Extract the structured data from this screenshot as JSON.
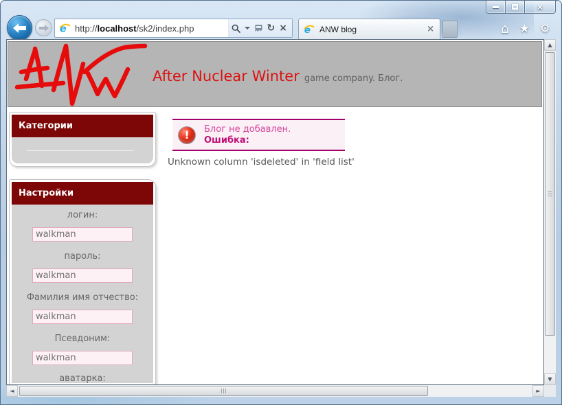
{
  "browser": {
    "url": {
      "prefix": "http://",
      "host": "localhost",
      "path": "/sk2/index.php"
    },
    "tab_title": "ANW blog"
  },
  "icons": {
    "minimize": "",
    "maximize": "",
    "close": "×",
    "refresh": "↻",
    "stop": "×",
    "tab_close": "×",
    "home": "⌂",
    "favorites": "★",
    "tools": "⚙",
    "scroll_up": "▲",
    "scroll_down": "▼",
    "scroll_left": "◄",
    "scroll_right": "►",
    "error_mark": "!"
  },
  "header": {
    "logo_alt": "ANW",
    "title": "After Nuclear Winter",
    "subtitle": "game company. Блог."
  },
  "sidebar": {
    "sections": [
      {
        "title": "Категории"
      },
      {
        "title": "Настройки"
      }
    ],
    "fields": [
      {
        "label": "логин:",
        "value": "walkman"
      },
      {
        "label": "пароль:",
        "value": "walkman"
      },
      {
        "label": "Фамилия имя отчество:",
        "value": "walkman"
      },
      {
        "label": "Псевдоним:",
        "value": "walkman"
      },
      {
        "label": "аватарка:",
        "value": ""
      }
    ]
  },
  "main": {
    "error": {
      "line1": "Блог не добавлен.",
      "line2": "Ошибка:"
    },
    "detail": "Unknown column 'isdeleted' in 'field list'"
  },
  "colors": {
    "accent_red": "#e60c0c",
    "header_maroon": "#7d0606",
    "error_border": "#a2016b",
    "error_text": "#d6459a",
    "error_bold": "#bf1077",
    "input_bg": "#fdf1f6",
    "input_border": "#e0a9be",
    "band_gray": "#b5b5b5"
  }
}
